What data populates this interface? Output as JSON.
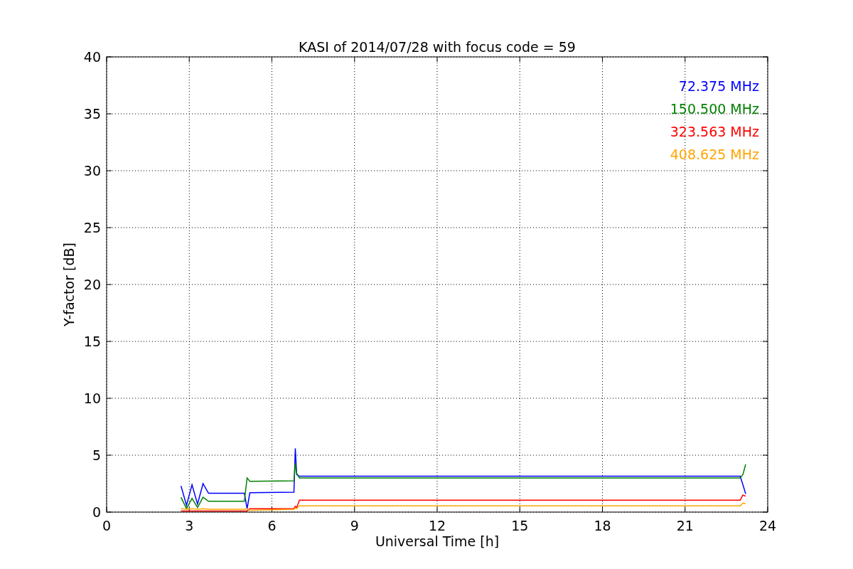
{
  "chart_data": {
    "type": "line",
    "title": "KASI of 2014/07/28 with focus code = 59",
    "xlabel": "Universal Time [h]",
    "ylabel": "Y-factor [dB]",
    "x": [
      2.7,
      2.9,
      3.1,
      3.3,
      3.5,
      3.7,
      5.0,
      5.1,
      5.2,
      6.8,
      6.85,
      6.9,
      7.0,
      23.0,
      23.1,
      23.2
    ],
    "series": [
      {
        "name": "72.375 MHz",
        "color": "#0000ff",
        "values": [
          2.3,
          0.6,
          2.4,
          0.7,
          2.5,
          1.65,
          1.65,
          0.3,
          1.7,
          1.75,
          5.6,
          3.3,
          3.15,
          3.15,
          2.4,
          1.6
        ]
      },
      {
        "name": "150.500 MHz",
        "color": "#008000",
        "values": [
          1.3,
          0.3,
          1.2,
          0.4,
          1.3,
          0.95,
          0.95,
          3.0,
          2.7,
          2.75,
          4.3,
          3.4,
          3.0,
          3.0,
          3.3,
          4.2
        ]
      },
      {
        "name": "323.563 MHz",
        "color": "#ff0000",
        "values": [
          0.1,
          0.1,
          0.1,
          0.1,
          0.1,
          0.1,
          0.1,
          0.1,
          0.3,
          0.3,
          0.5,
          0.4,
          1.05,
          1.05,
          1.5,
          1.4
        ]
      },
      {
        "name": "408.625 MHz",
        "color": "#ffa500",
        "values": [
          0.3,
          0.25,
          0.3,
          0.25,
          0.3,
          0.25,
          0.25,
          0.3,
          0.15,
          0.25,
          0.35,
          0.3,
          0.55,
          0.55,
          0.8,
          0.75
        ]
      }
    ],
    "grid": true,
    "xlim": [
      0,
      24
    ],
    "ylim": [
      0,
      40
    ],
    "xticks": [
      0,
      3,
      6,
      9,
      12,
      15,
      18,
      21,
      24
    ],
    "yticks": [
      0,
      5,
      10,
      15,
      20,
      25,
      30,
      35,
      40
    ]
  }
}
